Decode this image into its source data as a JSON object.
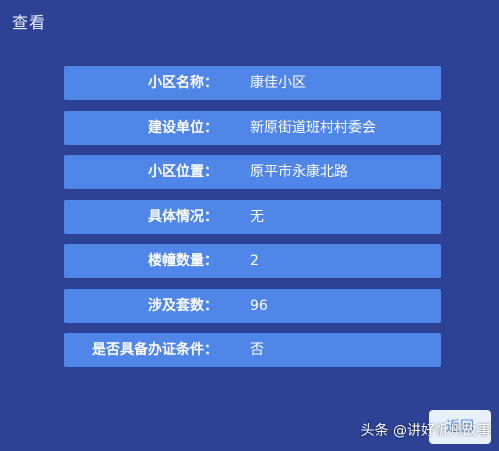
{
  "dialog": {
    "title": "查看",
    "back_label": "返回"
  },
  "rows": [
    {
      "label": "小区名称：",
      "value": "康佳小区"
    },
    {
      "label": "建设单位：",
      "value": "新原街道班村村委会"
    },
    {
      "label": "小区位置：",
      "value": "原平市永康北路"
    },
    {
      "label": "具体情况：",
      "value": "无"
    },
    {
      "label": "楼幢数量：",
      "value": "2"
    },
    {
      "label": "涉及套数：",
      "value": "96"
    },
    {
      "label": "是否具备办证条件：",
      "value": "否"
    }
  ],
  "watermark": "头条 @讲好忻州故事",
  "colors": {
    "background": "#2d4195",
    "row": "#4f86e7",
    "button": "#e8f0fb"
  }
}
